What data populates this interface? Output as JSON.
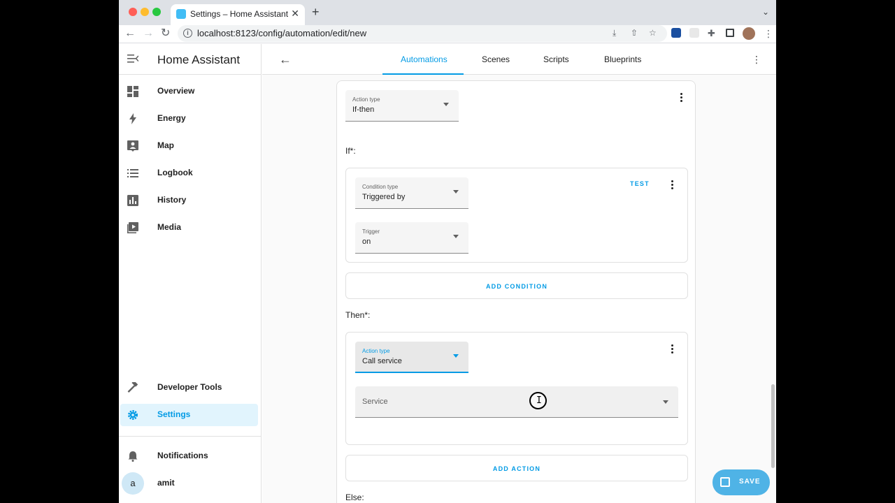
{
  "browser": {
    "tab_title": "Settings – Home Assistant",
    "tab_close": "✕",
    "new_tab": "+",
    "url": "localhost:8123/config/automation/edit/new"
  },
  "app": {
    "title": "Home Assistant"
  },
  "sidebar": {
    "items": [
      {
        "label": "Overview",
        "icon": "dashboard-icon"
      },
      {
        "label": "Energy",
        "icon": "lightning-icon"
      },
      {
        "label": "Map",
        "icon": "map-icon"
      },
      {
        "label": "Logbook",
        "icon": "list-icon"
      },
      {
        "label": "History",
        "icon": "chart-icon"
      },
      {
        "label": "Media",
        "icon": "play-icon"
      }
    ],
    "developer_tools": "Developer Tools",
    "settings": "Settings",
    "notifications": "Notifications",
    "user_initial": "a",
    "user_name": "amit",
    "accent_color": "#039be5"
  },
  "header": {
    "tabs": [
      "Automations",
      "Scenes",
      "Scripts",
      "Blueprints"
    ],
    "active_tab": "Automations"
  },
  "editor": {
    "action_type_label": "Action type",
    "action_type_value": "If-then",
    "if_label": "If*:",
    "condition_type_label": "Condition type",
    "condition_type_value": "Triggered by",
    "test_button": "TEST",
    "trigger_label": "Trigger",
    "trigger_value": "on",
    "add_condition": "ADD CONDITION",
    "then_label": "Then*:",
    "then_action_type_label": "Action type",
    "then_action_type_value": "Call service",
    "service_placeholder": "Service",
    "add_action": "ADD ACTION",
    "else_label": "Else:"
  },
  "fab": {
    "label": "SAVE"
  }
}
